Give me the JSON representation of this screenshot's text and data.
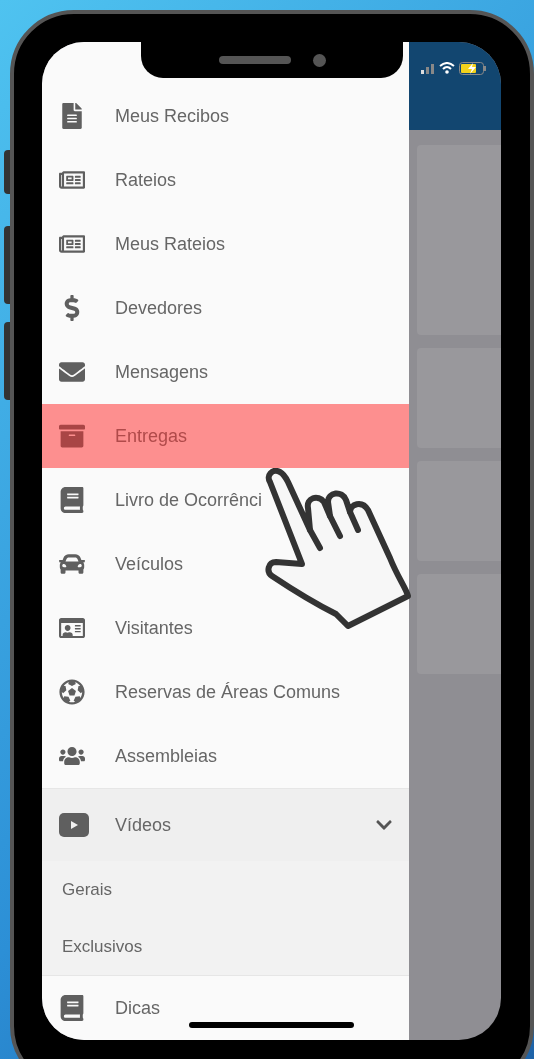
{
  "menu": [
    {
      "kind": "item",
      "label": "Meus Recibos",
      "selected": false
    },
    {
      "kind": "item",
      "label": "Rateios",
      "selected": false
    },
    {
      "kind": "item",
      "label": "Meus Rateios",
      "selected": false
    },
    {
      "kind": "item",
      "label": "Devedores",
      "selected": false
    },
    {
      "kind": "item",
      "label": "Mensagens",
      "selected": false
    },
    {
      "kind": "item",
      "label": "Entregas",
      "selected": true
    },
    {
      "kind": "item",
      "label": "Livro de Ocorrênci",
      "selected": false
    },
    {
      "kind": "item",
      "label": "Veículos",
      "selected": false
    },
    {
      "kind": "item",
      "label": "Visitantes",
      "selected": false
    },
    {
      "kind": "item",
      "label": "Reservas de Áreas Comuns",
      "selected": false
    },
    {
      "kind": "item",
      "label": "Assembleias",
      "selected": false
    },
    {
      "kind": "group",
      "label": "Vídeos",
      "expanded": true,
      "selected": false,
      "children": [
        {
          "label": "Gerais",
          "selected": false
        },
        {
          "label": "Exclusivos",
          "selected": false
        }
      ]
    },
    {
      "kind": "item",
      "label": "Dicas",
      "selected": false
    }
  ]
}
